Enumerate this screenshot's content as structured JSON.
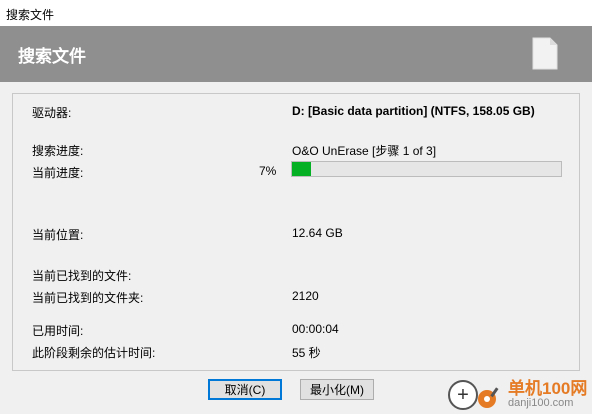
{
  "window": {
    "title": "搜索文件"
  },
  "header": {
    "title": "搜索文件",
    "icon": "document-icon"
  },
  "fields": {
    "drive_label": "驱动器:",
    "drive_value": "D: [Basic data partition] (NTFS, 158.05 GB)",
    "search_progress_label": "搜索进度:",
    "search_progress_value": "O&O UnErase [步骤 1 of 3]",
    "current_progress_label": "当前进度:",
    "current_progress_percent": "7%",
    "current_progress_fraction": 0.07,
    "current_position_label": "当前位置:",
    "current_position_value": "12.64 GB",
    "files_found_label": "当前已找到的文件:",
    "folders_found_label": "当前已找到的文件夹:",
    "folders_found_value": "2120",
    "elapsed_label": "已用时间:",
    "elapsed_value": "00:00:04",
    "remaining_label": "此阶段剩余的估计时间:",
    "remaining_value": "55 秒"
  },
  "buttons": {
    "cancel": "取消(C)",
    "minimize": "最小化(M)"
  },
  "watermark": {
    "logo": "单机100网",
    "site": "danji100.com"
  },
  "colors": {
    "progress_fill": "#06b025",
    "header_bg": "#8f8f8f",
    "accent": "#0078d7"
  }
}
